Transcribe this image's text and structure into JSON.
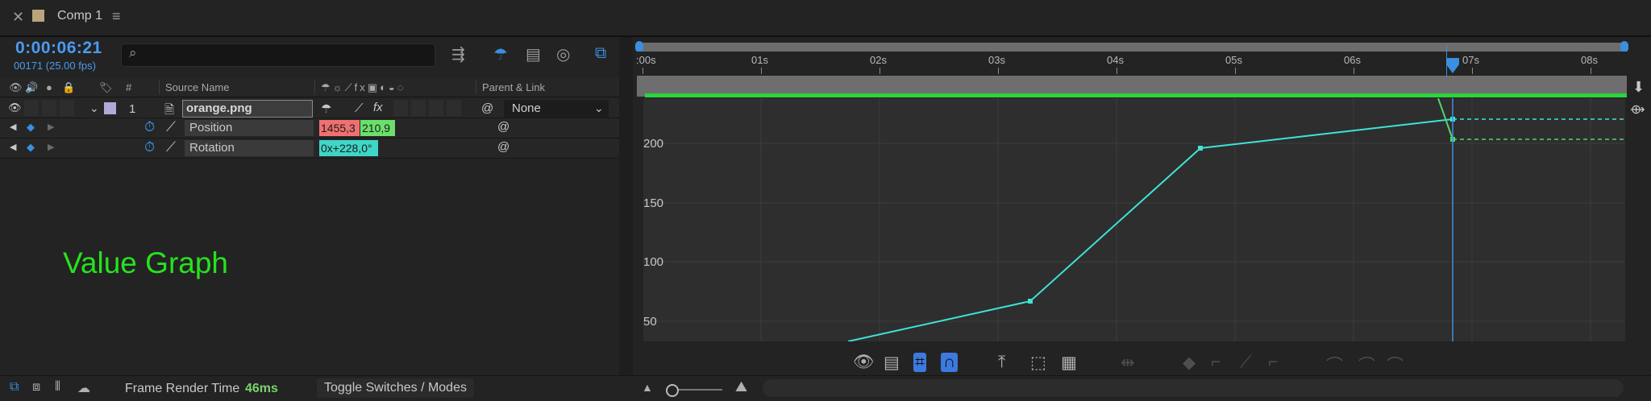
{
  "tab": {
    "title": "Comp 1",
    "close_icon": "✕",
    "menu_icon": "≡"
  },
  "time": {
    "timecode": "0:00:06:21",
    "fps": "00171 (25.00 fps)"
  },
  "search": {
    "placeholder": "",
    "icon": "search-icon"
  },
  "columns": {
    "source_name": "Source Name",
    "number": "#",
    "parent_link": "Parent & Link"
  },
  "layer": {
    "number": "1",
    "name": "orange.png",
    "parent": "None"
  },
  "properties": [
    {
      "name": "Position",
      "value_x": "1455,3",
      "value_y": "210,9"
    },
    {
      "name": "Rotation",
      "value": "0x+228,0°"
    }
  ],
  "overlay_label": "Value Graph",
  "ruler": {
    "labels": [
      ":00s",
      "01s",
      "02s",
      "03s",
      "04s",
      "05s",
      "06s",
      "07s",
      "08s"
    ]
  },
  "graph": {
    "y_labels": [
      "200",
      "150",
      "100",
      "50"
    ],
    "colors": {
      "position": "#3fe3d7",
      "rotation": "#4fd86a",
      "playhead": "#3a8fe0"
    }
  },
  "status": {
    "frame_render_label": "Frame Render Time",
    "frame_render_value": "46ms",
    "toggle_label": "Toggle Switches / Modes"
  }
}
